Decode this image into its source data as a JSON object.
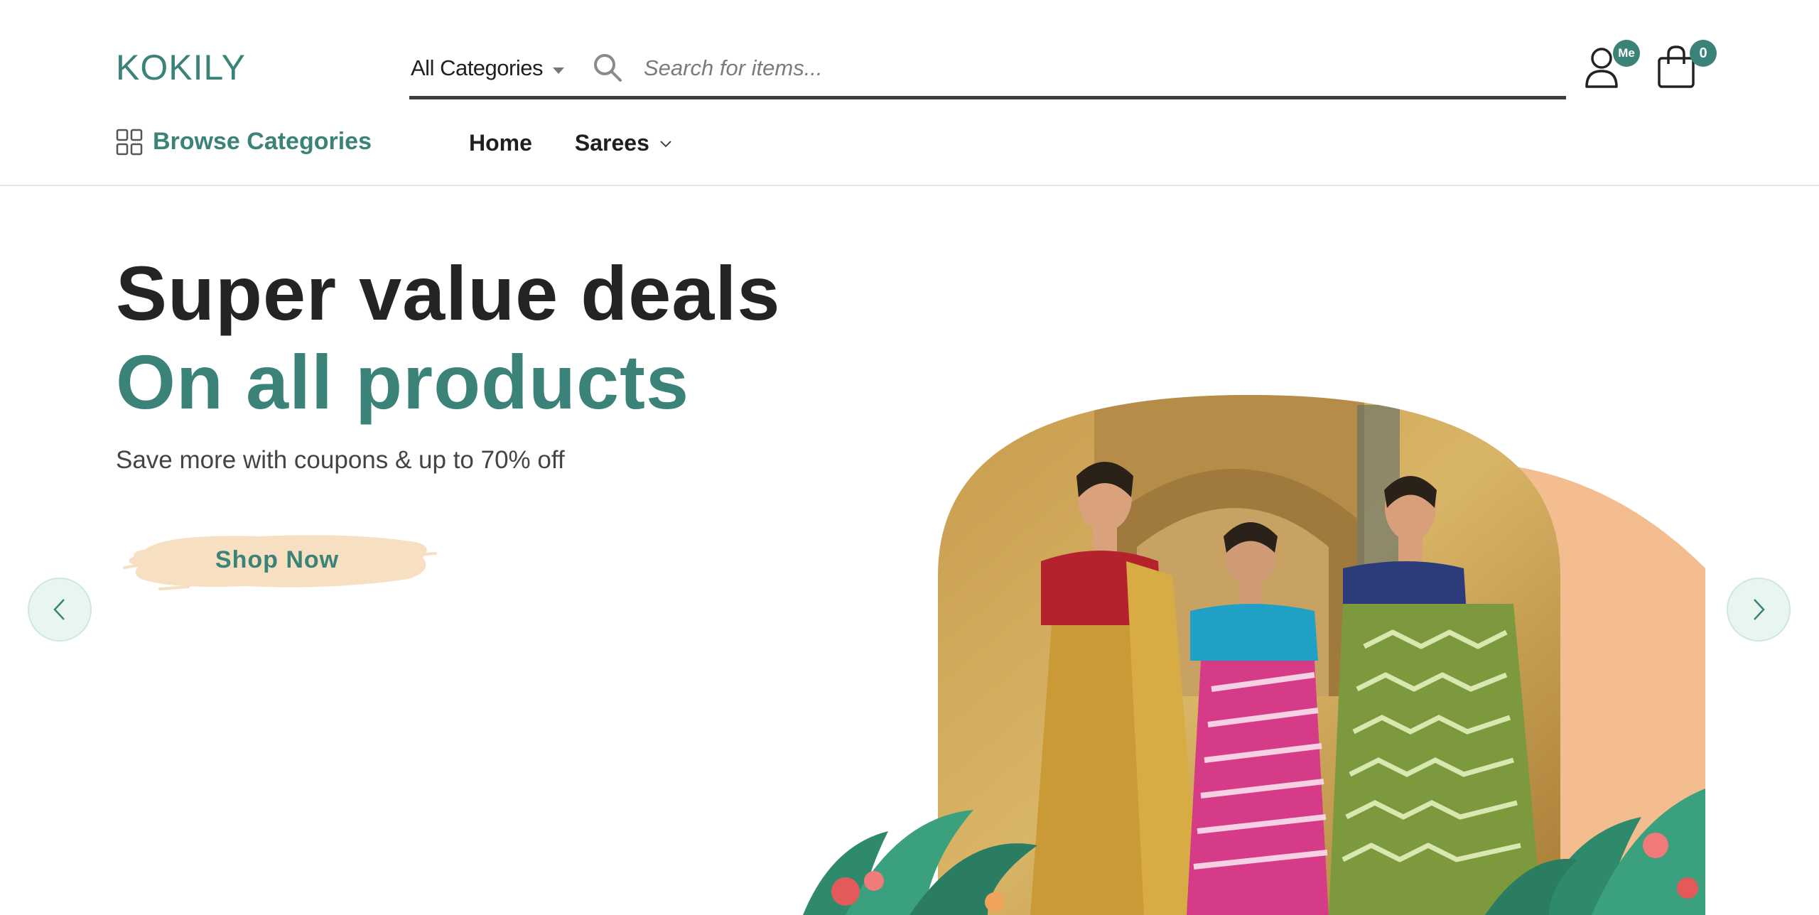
{
  "brand": {
    "name": "KOKILY"
  },
  "search": {
    "category_label": "All Categories",
    "placeholder": "Search for items..."
  },
  "header_icons": {
    "account_badge": "Me",
    "cart_count": "0"
  },
  "browse": {
    "label": "Browse Categories"
  },
  "nav": {
    "items": [
      {
        "label": "Home"
      },
      {
        "label": "Sarees"
      }
    ]
  },
  "hero": {
    "headline": "Super value deals",
    "subheadline": "On all products",
    "tagline": "Save more with coupons & up to 70% off",
    "cta_label": "Shop Now"
  },
  "colors": {
    "accent": "#3b8378",
    "headline": "#242424",
    "cta_brush": "#f7dfc1",
    "peach_shape": "#f3bd90",
    "arrow_bg": "#e9f6ef"
  },
  "icons": {
    "search": "search-icon",
    "user": "user-icon",
    "cart": "shopping-bag-icon",
    "grid": "grid-icon",
    "prev": "chevron-left-icon",
    "next": "chevron-right-icon"
  }
}
